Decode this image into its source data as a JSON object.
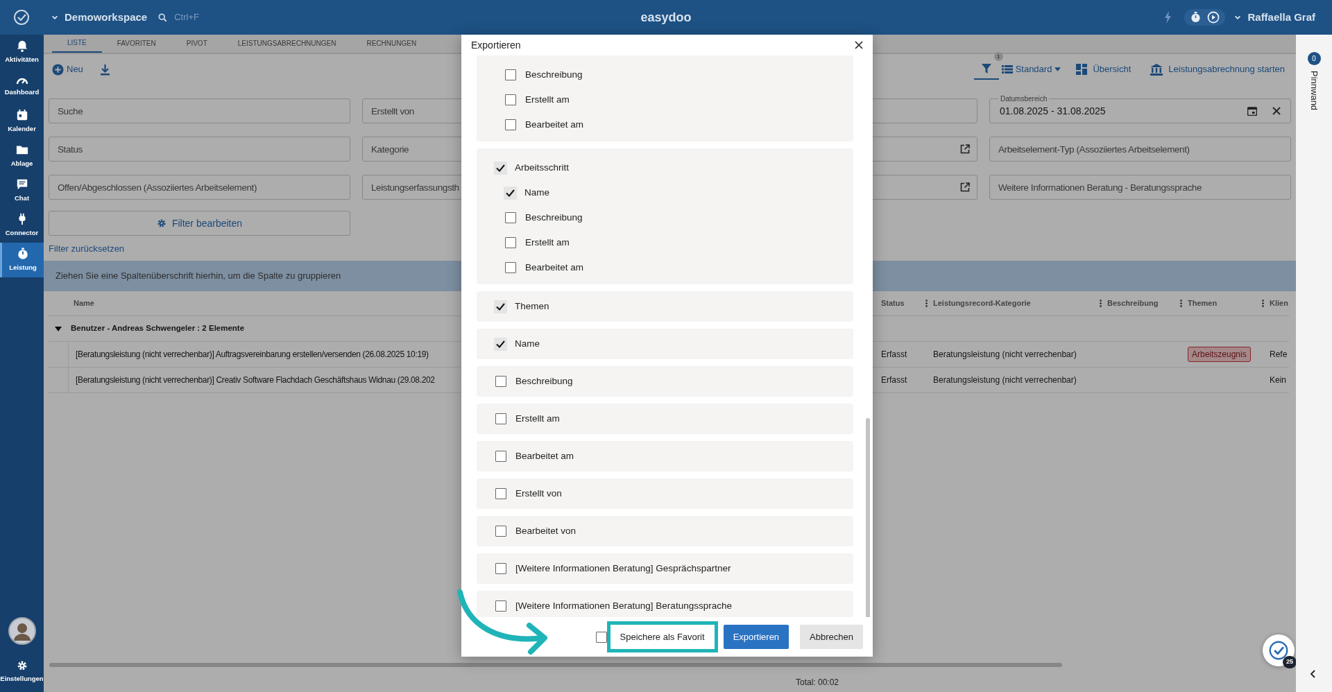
{
  "app": {
    "workspace": "Demoworkspace",
    "search": {
      "placeholder": "Ctrl+F"
    },
    "title": "easydoo",
    "user": "Raffaella Graf"
  },
  "sidebar": {
    "items": [
      {
        "label": "Aktivitäten",
        "selected": false
      },
      {
        "label": "Dashboard",
        "selected": false
      },
      {
        "label": "Kalender",
        "selected": false
      },
      {
        "label": "Ablage",
        "selected": false
      },
      {
        "label": "Chat",
        "selected": false
      },
      {
        "label": "Connector",
        "selected": false
      },
      {
        "label": "Leistung",
        "selected": true
      }
    ],
    "settings": "Einstellungen"
  },
  "tabs": [
    {
      "label": "LISTE",
      "selected": true
    },
    {
      "label": "FAVORITEN",
      "selected": false
    },
    {
      "label": "PIVOT",
      "selected": false
    },
    {
      "label": "LEISTUNGSABRECHNUNGEN",
      "selected": false
    },
    {
      "label": "RECHNUNGEN",
      "selected": false
    }
  ],
  "toolbar": {
    "new": "Neu",
    "filter_count": "1",
    "view": "Standard",
    "overview": "Übersicht",
    "start_billing": "Leistungsabrechnung starten"
  },
  "filter_rows": [
    {
      "fields": [
        {
          "kind": "text",
          "placeholder": "Suche"
        },
        {
          "kind": "text",
          "placeholder": "Erstellt von"
        },
        {
          "kind": "text"
        },
        {
          "kind": "date",
          "label": "Datumsbereich",
          "value": "01.08.2025 - 31.08.2025"
        }
      ]
    },
    {
      "fields": [
        {
          "kind": "text",
          "placeholder": "Status"
        },
        {
          "kind": "text",
          "placeholder": "Kategorie"
        },
        {
          "kind": "link"
        },
        {
          "kind": "text",
          "placeholder": "Arbeitselement-Typ (Assoziiertes Arbeitselement)"
        }
      ]
    },
    {
      "fields": [
        {
          "kind": "text",
          "placeholder": "Offen/Abgeschlossen (Assoziiertes Arbeitselement)"
        },
        {
          "kind": "text",
          "placeholder": "Leistungserfassungsth"
        },
        {
          "kind": "link"
        },
        {
          "kind": "text",
          "placeholder": "Weitere Informationen Beratung - Beratungssprache"
        }
      ]
    }
  ],
  "filter_edit": "Filter bearbeiten",
  "filter_reset": "Filter zurücksetzen",
  "group_hint": "Ziehen Sie eine Spaltenüberschrift hierhin, um die Spalte zu gruppieren",
  "table": {
    "columns": [
      "Name",
      "Status",
      "Leistungsrecord-Kategorie",
      "Beschreibung",
      "Themen",
      "Klien"
    ],
    "group": {
      "label": "Benutzer - Andreas Schwengeler : 2 Elemente",
      "expanded": true
    },
    "rows": [
      {
        "name": "[Beratungsleistung (nicht verrechenbar)] Auftragsvereinbarung erstellen/versenden (26.08.2025 10:19)",
        "status": "Erfasst",
        "category": "Beratungsleistung (nicht verrechenbar)",
        "tags": [
          "Arbeitszeugnis"
        ],
        "client": "Refe"
      },
      {
        "name": "[Beratungsleistung (nicht verrechenbar)] Creativ Software Flachdach Geschäftshaus Widnau (29.08.202",
        "status": "Erfasst",
        "category": "Beratungsleistung (nicht verrechenbar)",
        "tags": [],
        "client": "Kein"
      }
    ]
  },
  "total": "Total: 00:02",
  "pinboard": {
    "label": "Pinnwand",
    "count": "0"
  },
  "notifications": "25",
  "modal": {
    "title": "Exportieren",
    "groups": [
      {
        "children": [
          {
            "label": "Beschreibung",
            "checked": false
          },
          {
            "label": "Erstellt am",
            "checked": false
          },
          {
            "label": "Bearbeitet am",
            "checked": false
          }
        ]
      },
      {
        "label": "Arbeitsschritt",
        "checked": true,
        "children": [
          {
            "label": "Name",
            "checked": true
          },
          {
            "label": "Beschreibung",
            "checked": false
          },
          {
            "label": "Erstellt am",
            "checked": false
          },
          {
            "label": "Bearbeitet am",
            "checked": false
          }
        ]
      },
      {
        "label": "Themen",
        "checked": true
      },
      {
        "label": "Name",
        "checked": true
      },
      {
        "label": "Beschreibung",
        "checked": false
      },
      {
        "label": "Erstellt am",
        "checked": false
      },
      {
        "label": "Bearbeitet am",
        "checked": false
      },
      {
        "label": "Erstellt von",
        "checked": false
      },
      {
        "label": "Bearbeitet von",
        "checked": false
      },
      {
        "label": "[Weitere Informationen Beratung] Gesprächspartner",
        "checked": false
      },
      {
        "label": "[Weitere Informationen Beratung] Beratungssprache",
        "checked": false
      }
    ],
    "favorite": {
      "label": "Speichere als Favorit",
      "checked": false,
      "highlighted": true
    },
    "buttons": [
      {
        "label": "Exportieren",
        "kind": "primary"
      },
      {
        "label": "Abbrechen",
        "kind": "secondary"
      }
    ]
  }
}
